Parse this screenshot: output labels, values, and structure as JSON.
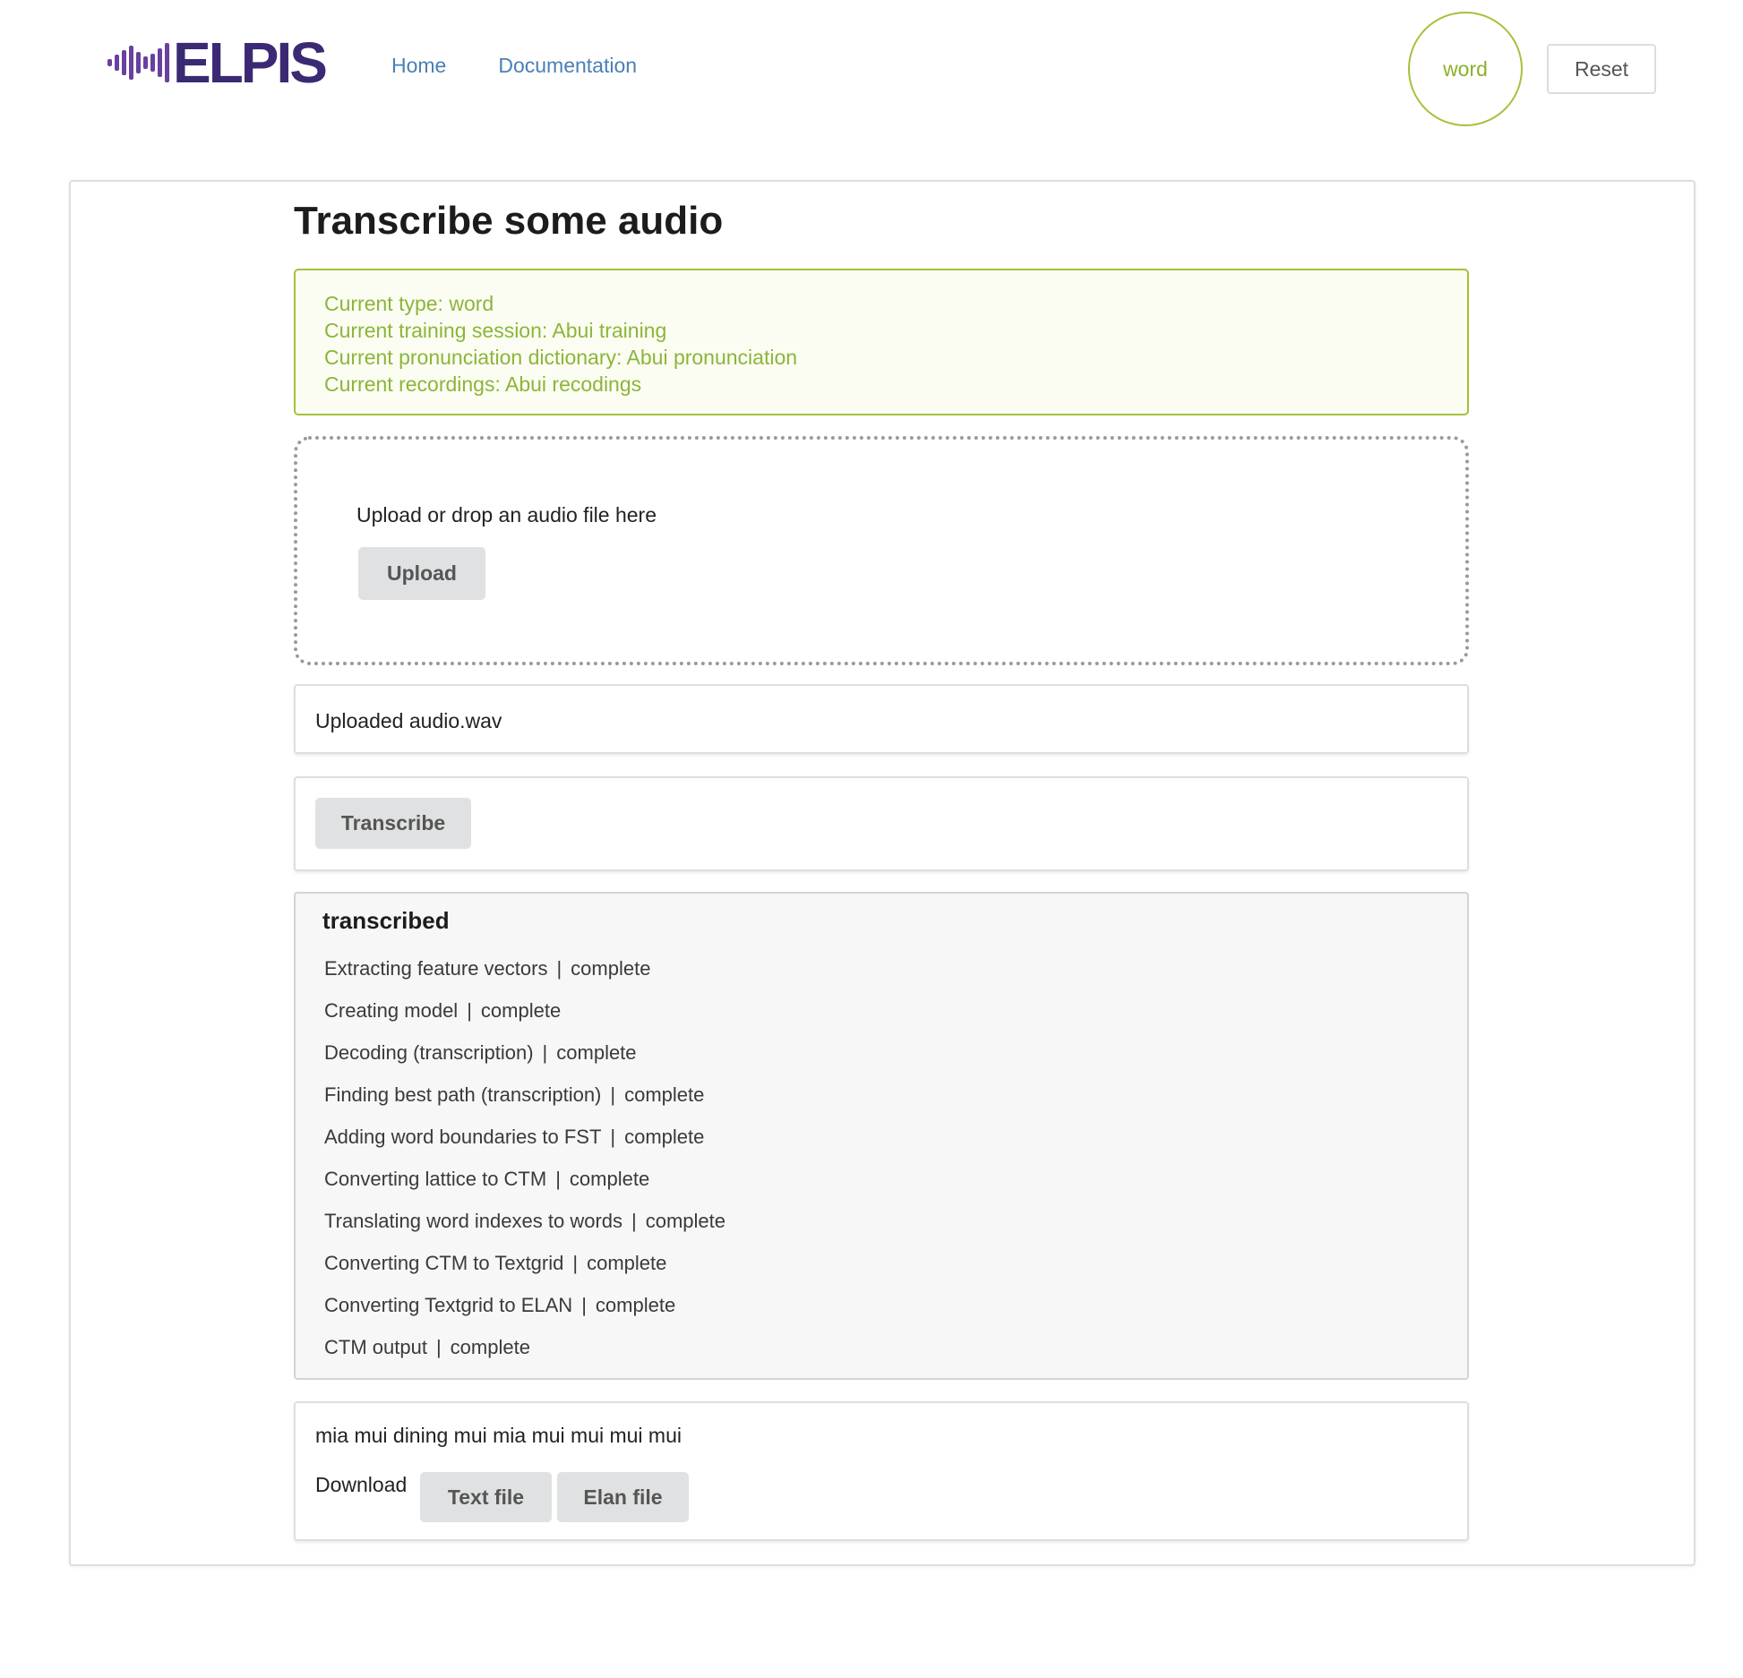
{
  "header": {
    "logo_text": "ELPIS",
    "nav": [
      {
        "label": "Home"
      },
      {
        "label": "Documentation"
      }
    ],
    "current_type_badge": "word",
    "reset_label": "Reset"
  },
  "page": {
    "title": "Transcribe some audio"
  },
  "info": {
    "lines": [
      "Current type: word",
      "Current training session: Abui training",
      "Current pronunciation dictionary: Abui pronunciation",
      "Current recordings: Abui recodings"
    ]
  },
  "upload": {
    "prompt": "Upload or drop an audio file here",
    "button_label": "Upload",
    "uploaded_text": "Uploaded audio.wav"
  },
  "transcribe": {
    "button_label": "Transcribe"
  },
  "status": {
    "title": "transcribed",
    "separator": "|",
    "steps": [
      {
        "name": "Extracting feature vectors",
        "state": "complete"
      },
      {
        "name": "Creating model",
        "state": "complete"
      },
      {
        "name": "Decoding (transcription)",
        "state": "complete"
      },
      {
        "name": "Finding best path (transcription)",
        "state": "complete"
      },
      {
        "name": "Adding word boundaries to FST",
        "state": "complete"
      },
      {
        "name": "Converting lattice to CTM",
        "state": "complete"
      },
      {
        "name": "Translating word indexes to words",
        "state": "complete"
      },
      {
        "name": "Converting CTM to Textgrid",
        "state": "complete"
      },
      {
        "name": "Converting Textgrid to ELAN",
        "state": "complete"
      },
      {
        "name": "CTM output",
        "state": "complete"
      }
    ]
  },
  "result": {
    "transcription": "mia mui dining mui mia mui mui mui mui",
    "download_label": "Download",
    "text_file_label": "Text file",
    "elan_file_label": "Elan file"
  },
  "colors": {
    "accent_green": "#a3c23a",
    "link_blue": "#4a7fb5",
    "logo_purple": "#3b2a73"
  }
}
